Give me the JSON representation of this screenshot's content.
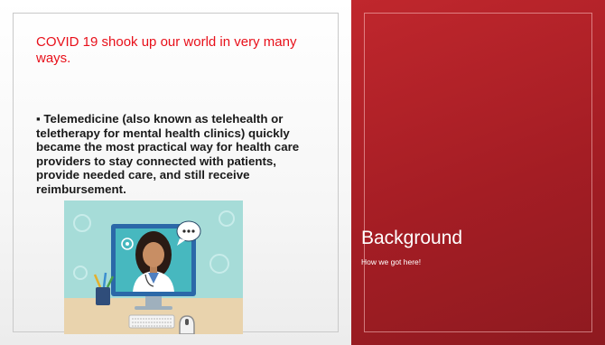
{
  "slide": {
    "left_panel": {
      "heading": "COVID 19 shook up our world in very many ways.",
      "paragraph": "▪ Telemedicine (also known as telehealth or teletherapy for mental health clinics) quickly became the most practical way for health care providers to stay connected with patients, provide needed care, and still receive reimbursement."
    },
    "right_panel": {
      "title": "Background",
      "subtitle": "How we got here!"
    }
  },
  "colors": {
    "heading": "#e8101a",
    "right_background": "#a41d24",
    "illustration_teal": "#a6dcd8",
    "monitor": "#2b68a8"
  },
  "icons": [
    "chat-bubble-icon",
    "location-pin-icon",
    "pencil-cup-icon",
    "keyboard-icon",
    "mouse-icon"
  ]
}
